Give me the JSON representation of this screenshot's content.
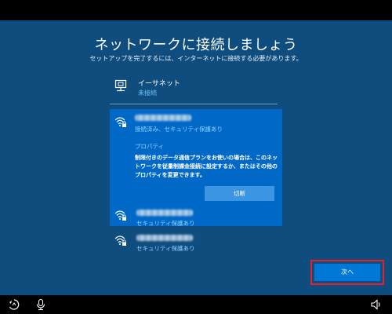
{
  "page": {
    "title": "ネットワークに接続しましょう",
    "subtitle": "セットアップを完了するには、インターネットに接続する必要があります。"
  },
  "ethernet": {
    "name": "イーサネット",
    "status": "未接続",
    "icon": "ethernet-icon"
  },
  "selected_network": {
    "status": "接続済み、セキュリティ保護あり",
    "properties_link": "プロパティ",
    "description": "制限付きのデータ通信プランをお使いの場合は、このネットワークを従量制課金接続に設定するか、またはその他のプロパティを変更できます。",
    "disconnect_label": "切断",
    "icon": "wifi-secured-icon"
  },
  "networks": [
    {
      "status": "セキュリティ保護あり",
      "icon": "wifi-secured-icon"
    },
    {
      "status": "セキュリティ保護あり",
      "icon": "wifi-secured-icon"
    }
  ],
  "footer": {
    "next_label": "次へ",
    "icons": [
      "ease-of-access-icon",
      "microphone-icon",
      "volume-icon"
    ]
  },
  "colors": {
    "background": "#0f4d7e",
    "selected_bg": "#0069c7",
    "accent_text": "#8ed2ff",
    "button": "#0078d7",
    "highlight_border": "#e3212d"
  }
}
